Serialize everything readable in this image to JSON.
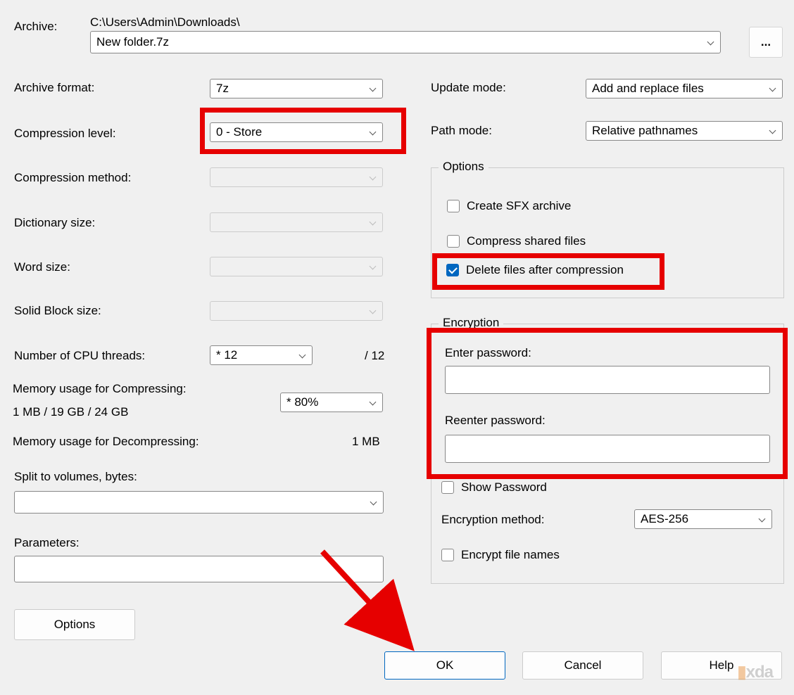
{
  "archive": {
    "label": "Archive:",
    "path": "C:\\Users\\Admin\\Downloads\\",
    "filename": "New folder.7z",
    "browse": "..."
  },
  "left": {
    "format_label": "Archive format:",
    "format_value": "7z",
    "level_label": "Compression level:",
    "level_value": "0 - Store",
    "method_label": "Compression method:",
    "method_value": "",
    "dict_label": "Dictionary size:",
    "dict_value": "",
    "word_label": "Word size:",
    "word_value": "",
    "block_label": "Solid Block size:",
    "block_value": "",
    "cpu_label": "Number of CPU threads:",
    "cpu_value": "* 12",
    "cpu_total": "/ 12",
    "mem_comp_label": "Memory usage for Compressing:",
    "mem_comp_value": "1 MB / 19 GB / 24 GB",
    "mem_comp_pct": "* 80%",
    "mem_dec_label": "Memory usage for Decompressing:",
    "mem_dec_value": "1 MB",
    "split_label": "Split to volumes, bytes:",
    "split_value": "",
    "params_label": "Parameters:",
    "params_value": "",
    "options_btn": "Options"
  },
  "right": {
    "update_label": "Update mode:",
    "update_value": "Add and replace files",
    "path_label": "Path mode:",
    "path_value": "Relative pathnames",
    "options_legend": "Options",
    "sfx_label": "Create SFX archive",
    "shared_label": "Compress shared files",
    "delete_label": "Delete files after compression",
    "enc_legend": "Encryption",
    "enter_pw": "Enter password:",
    "reenter_pw": "Reenter password:",
    "show_pw": "Show Password",
    "enc_method_label": "Encryption method:",
    "enc_method_value": "AES-256",
    "enc_names": "Encrypt file names"
  },
  "buttons": {
    "ok": "OK",
    "cancel": "Cancel",
    "help": "Help"
  }
}
